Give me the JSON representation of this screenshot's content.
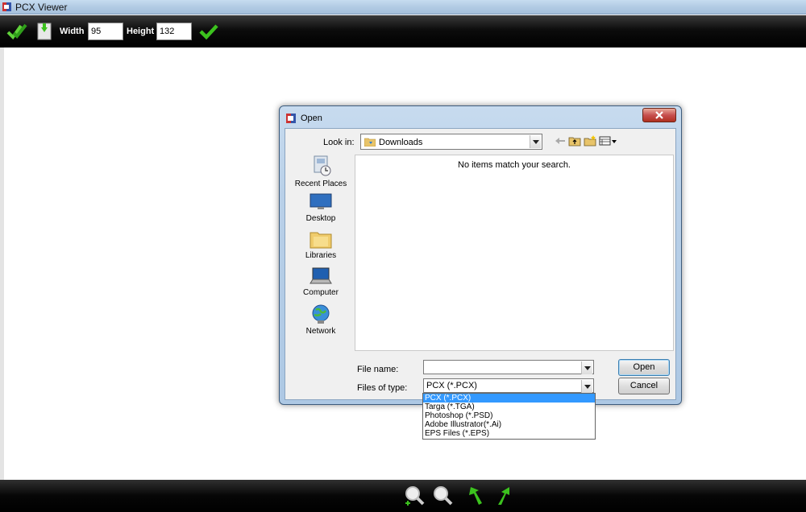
{
  "window": {
    "title": "PCX Viewer"
  },
  "toolbar": {
    "width_label": "Width",
    "width_value": "95",
    "height_label": "Height",
    "height_value": "132",
    "icons": [
      "checkmark-double-icon",
      "save-icon",
      "apply-checkmark-icon"
    ]
  },
  "bottombar": {
    "icons": [
      "zoom-in-icon",
      "zoom-out-icon",
      "rotate-left-icon",
      "rotate-right-icon"
    ]
  },
  "dialog": {
    "title": "Open",
    "look_in_label": "Look in:",
    "look_in_value": "Downloads",
    "empty_message": "No items match your search.",
    "places": [
      {
        "label": "Recent Places",
        "icon": "recent-places-icon"
      },
      {
        "label": "Desktop",
        "icon": "desktop-icon"
      },
      {
        "label": "Libraries",
        "icon": "libraries-icon"
      },
      {
        "label": "Computer",
        "icon": "computer-icon"
      },
      {
        "label": "Network",
        "icon": "network-icon"
      }
    ],
    "file_name_label": "File name:",
    "file_name_value": "",
    "files_of_type_label": "Files of type:",
    "files_of_type_value": "PCX (*.PCX)",
    "open_button": "Open",
    "cancel_button": "Cancel",
    "type_options": [
      "PCX (*.PCX)",
      "Targa (*.TGA)",
      "Photoshop (*.PSD)",
      "Adobe Illustrator(*.Ai)",
      "EPS Files (*.EPS)"
    ],
    "selected_option_index": 0
  },
  "colors": {
    "selection": "#3399ff",
    "toolbar_bg": "#000000",
    "accent_green": "#3cc21e"
  }
}
